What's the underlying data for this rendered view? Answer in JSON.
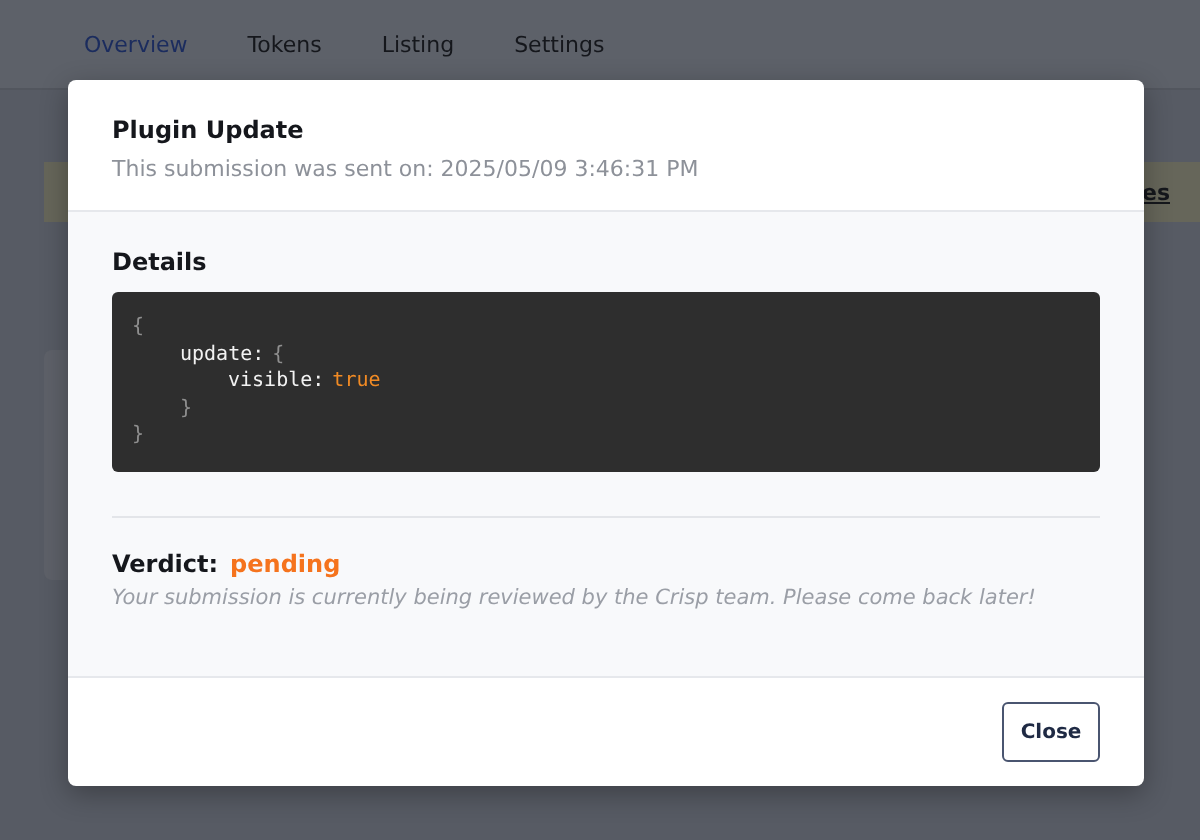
{
  "tabs": [
    {
      "label": "Overview",
      "selected": true
    },
    {
      "label": "Tokens",
      "selected": false
    },
    {
      "label": "Listing",
      "selected": false
    },
    {
      "label": "Settings",
      "selected": false
    }
  ],
  "banner": {
    "link": "es"
  },
  "modal": {
    "title": "Plugin Update",
    "subtitle": "This submission was sent on: 2025/05/09 3:46:31 PM",
    "details_label": "Details",
    "code": {
      "open": "{",
      "entries": [
        {
          "key": "update:",
          "open": "{",
          "entries": [
            {
              "key": "visible:",
              "value": "true"
            }
          ],
          "close": "}"
        }
      ],
      "close": "}"
    },
    "verdict_label": "Verdict:",
    "verdict": "pending",
    "verdict_note": "Your submission is currently being reviewed by the Crisp team. Please come back later!",
    "close_button": "Close"
  }
}
